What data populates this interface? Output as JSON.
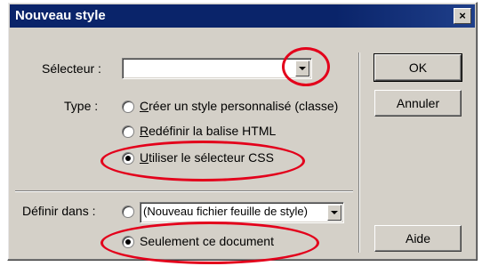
{
  "window": {
    "title": "Nouveau style",
    "close_label": "×"
  },
  "selecteur": {
    "label": "Sélecteur :",
    "value": ""
  },
  "type": {
    "label": "Type :",
    "options": [
      {
        "text": "Créer un style personnalisé (classe)",
        "mnemonic": "C",
        "rest": "réer un style personnalisé (classe)",
        "selected": false
      },
      {
        "text": "Redéfinir la balise HTML",
        "mnemonic": "R",
        "rest": "edéfinir la balise HTML",
        "selected": false
      },
      {
        "text": "Utiliser le sélecteur CSS",
        "mnemonic": "U",
        "rest": "tiliser le sélecteur CSS",
        "selected": true
      }
    ]
  },
  "definir": {
    "label": "Définir dans :",
    "stylesheet_value": "(Nouveau fichier feuille de style)",
    "stylesheet_selected": false,
    "document_option": "Seulement ce document",
    "document_selected": true
  },
  "buttons": {
    "ok": "OK",
    "cancel": "Annuler",
    "help": "Aide"
  },
  "colors": {
    "annotation": "#e3001b",
    "titlebar": "#0a246a",
    "face": "#d4d0c8"
  },
  "icons": {
    "dropdown": "chevron-down-icon",
    "close": "close-icon"
  }
}
